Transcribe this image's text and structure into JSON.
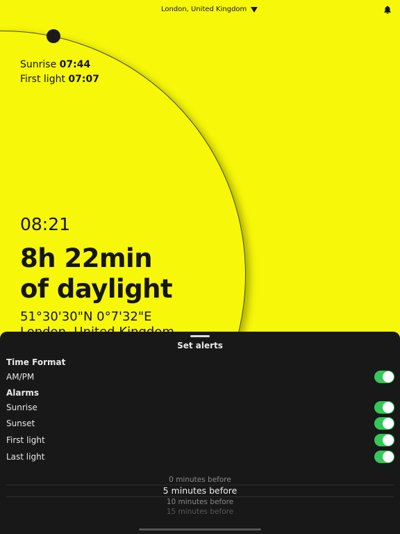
{
  "header": {
    "location": "London, United Kingdom"
  },
  "icons": {
    "dropdown": "caret-down-icon",
    "alerts": "bell-icon"
  },
  "sun": {
    "sunrise_label": "Sunrise",
    "sunrise_time": "07:44",
    "first_light_label": "First light",
    "first_light_time": "07:07",
    "current_time": "08:21",
    "daylight_line1": "8h 22min",
    "daylight_line2": "of daylight",
    "coordinates": "51°30'30\"N 0°7'32\"E",
    "location": "London, United Kingdom"
  },
  "sheet": {
    "title": "Set alerts",
    "time_format_heading": "Time Format",
    "ampm_label": "AM/PM",
    "ampm_on": true,
    "alarms_heading": "Alarms",
    "alarms": [
      {
        "label": "Sunrise",
        "on": true
      },
      {
        "label": "Sunset",
        "on": true
      },
      {
        "label": "First light",
        "on": true
      },
      {
        "label": "Last light",
        "on": true
      }
    ],
    "picker_options": [
      "0 minutes before",
      "5 minutes before",
      "10 minutes before",
      "15 minutes before"
    ],
    "picker_selected": "5 minutes before"
  },
  "colors": {
    "background": "#f7f70a",
    "sheet": "#181818",
    "toggle_on": "#34c759"
  }
}
